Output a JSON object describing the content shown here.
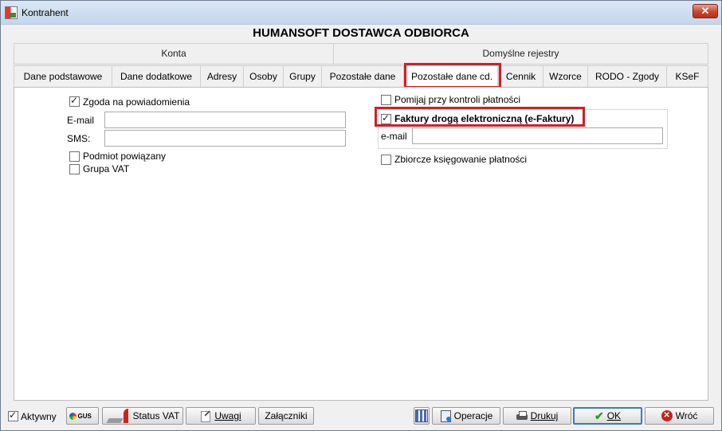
{
  "window": {
    "title": "Kontrahent",
    "close_glyph": "✕"
  },
  "heading": "HUMANSOFT DOSTAWCA ODBIORCA",
  "group_tabs": [
    {
      "label": "Konta"
    },
    {
      "label": "Domyślne rejestry"
    }
  ],
  "tabs": [
    {
      "label": "Dane podstawowe"
    },
    {
      "label": "Dane dodatkowe"
    },
    {
      "label": "Adresy"
    },
    {
      "label": "Osoby"
    },
    {
      "label": "Grupy"
    },
    {
      "label": "Pozostałe dane"
    },
    {
      "label": "Pozostałe dane cd.",
      "active": true
    },
    {
      "label": "Cennik"
    },
    {
      "label": "Wzorce"
    },
    {
      "label": "RODO - Zgody"
    },
    {
      "label": "KSeF"
    }
  ],
  "left": {
    "consent": {
      "label": "Zgoda na powiadomienia",
      "checked": true
    },
    "email": {
      "label": "E-mail",
      "value": ""
    },
    "sms": {
      "label": "SMS:",
      "value": ""
    },
    "related_entity": {
      "label": "Podmiot powiązany",
      "checked": false
    },
    "vat_group": {
      "label": "Grupa VAT",
      "checked": false
    }
  },
  "right": {
    "skip_payment_check": {
      "label": "Pomijaj przy kontroli płatności",
      "checked": false
    },
    "efaktury": {
      "label": "Faktury drogą elektroniczną (e-Faktury)",
      "checked": true
    },
    "efaktury_email": {
      "label": "e-mail",
      "value": ""
    },
    "collective_posting": {
      "label": "Zbiorcze księgowanie płatności",
      "checked": false
    }
  },
  "footer": {
    "active": {
      "label": "Aktywny",
      "checked": true
    },
    "gus": {
      "label": "GUS"
    },
    "status_vat": {
      "label": "Status VAT"
    },
    "notes": {
      "label": "Uwagi"
    },
    "attachments": {
      "label": "Załączniki"
    },
    "operations": {
      "label": "Operacje"
    },
    "print": {
      "label": "Drukuj"
    },
    "ok": {
      "label": "OK"
    },
    "back": {
      "label": "Wróć"
    }
  },
  "colors": {
    "highlight": "#d01f26",
    "ok_border": "#3b78c5",
    "titlebar": "#c3d6ec"
  }
}
